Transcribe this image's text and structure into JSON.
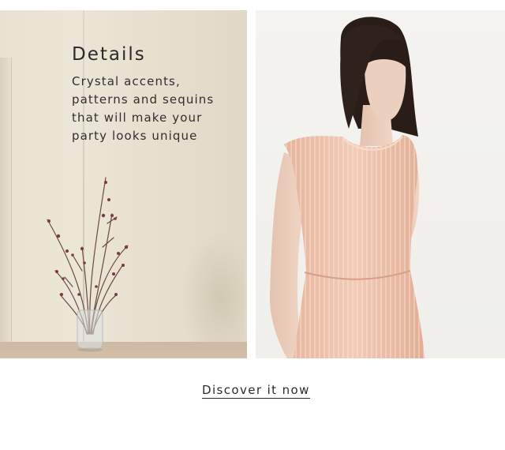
{
  "promo": {
    "title": "Details",
    "body_lines": [
      "Crystal accents,",
      "patterns and sequins",
      "that will make your",
      "party looks unique"
    ],
    "cta_label": "Discover it now"
  },
  "images": {
    "left": "room-with-vase-of-branches",
    "right": "model-in-peach-sequined-dress"
  },
  "colors": {
    "text": "#2a2a2a",
    "background": "#ffffff",
    "dress": "#efc3ad",
    "wall": "#e9e2d2"
  }
}
